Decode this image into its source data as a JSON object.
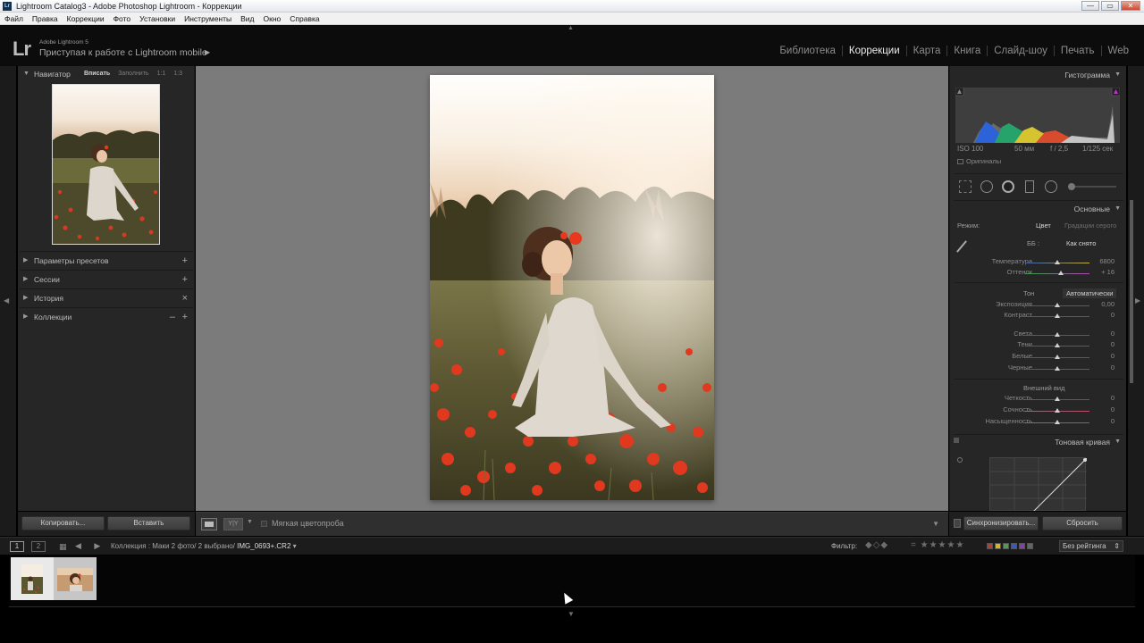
{
  "window": {
    "title": "Lightroom Catalog3 - Adobe Photoshop Lightroom - Коррекции",
    "app_icon": "Lr",
    "minimize": "—",
    "maximize": "▭",
    "close": "✕"
  },
  "menu": [
    "Файл",
    "Правка",
    "Коррекции",
    "Фото",
    "Установки",
    "Инструменты",
    "Вид",
    "Окно",
    "Справка"
  ],
  "identity": {
    "logo": "Lr",
    "version": "Adobe Lightroom 5",
    "mobile": "Приступая к работе с Lightroom mobile"
  },
  "modules": [
    {
      "label": "Библиотека",
      "active": false
    },
    {
      "label": "Коррекции",
      "active": true
    },
    {
      "label": "Карта",
      "active": false
    },
    {
      "label": "Книга",
      "active": false
    },
    {
      "label": "Слайд-шоу",
      "active": false
    },
    {
      "label": "Печать",
      "active": false
    },
    {
      "label": "Web",
      "active": false
    }
  ],
  "left_panel": {
    "navigator": {
      "title": "Навигатор",
      "opt_fit": "Вписать",
      "opt_fill": "Заполнить",
      "opt_1_1": "1:1",
      "opt_1_3": "1:3"
    },
    "presets": {
      "label": "Параметры пресетов",
      "action": "+"
    },
    "sessions": {
      "label": "Сессии",
      "action": "+"
    },
    "history": {
      "label": "История",
      "action": "×"
    },
    "collections": {
      "label": "Коллекции",
      "action_minus": "–",
      "action_plus": "+"
    },
    "copy_button": "Копировать...",
    "paste_button": "Вставить"
  },
  "right_panel": {
    "histogram": {
      "title": "Гистограмма",
      "iso": "ISO 100",
      "focal": "50 мм",
      "aperture": "f / 2,5",
      "shutter": "1/125 сек",
      "originals": "Оригиналы"
    },
    "basic": {
      "title": "Основные",
      "mode_label": "Режим:",
      "mode_color": "Цвет",
      "mode_gray": "Градации серого",
      "wb_label": "ББ :",
      "wb_value": "Как снято",
      "temp": {
        "label": "Температура",
        "value": "6800",
        "pos": 0.5
      },
      "tint": {
        "label": "Оттенок",
        "value": "+ 16",
        "pos": 0.55
      },
      "tone_label": "Тон",
      "auto": "Автоматически",
      "exposure": {
        "label": "Экспозиция",
        "value": "0,00",
        "pos": 0.5
      },
      "contrast": {
        "label": "Контраст",
        "value": "0",
        "pos": 0.5
      },
      "highlights": {
        "label": "Света",
        "value": "0",
        "pos": 0.5
      },
      "shadows": {
        "label": "Тени",
        "value": "0",
        "pos": 0.5
      },
      "whites": {
        "label": "Белые",
        "value": "0",
        "pos": 0.5
      },
      "blacks": {
        "label": "Черные",
        "value": "0",
        "pos": 0.5
      },
      "presence_label": "Внешний вид",
      "clarity": {
        "label": "Четкость",
        "value": "0",
        "pos": 0.5
      },
      "vibrance": {
        "label": "Сочность",
        "value": "0",
        "pos": 0.5
      },
      "saturation": {
        "label": "Насыщенность",
        "value": "0",
        "pos": 0.5
      }
    },
    "tone_curve": {
      "title": "Тоновая кривая"
    },
    "sync_button": "Синхронизировать...",
    "reset_button": "Сбросить"
  },
  "toolbar": {
    "soft_proof": "Мягкая цветопроба",
    "yy": "Y|Y",
    "menu_arrow": "▼"
  },
  "filmbar": {
    "mon1": "1",
    "mon2": "2",
    "arrows": "◀ ▶",
    "crumb_prefix": "Коллекция : Маки  2 фото/  2 выбрано/",
    "crumb_file": "IMG_0693+.CR2",
    "filter_label": "Фильтр:",
    "flags": "◆◇◆",
    "stars": "= ★★★★★",
    "rating_value": "Без рейтинга"
  },
  "colors": {
    "label_red": "#b83a3a",
    "label_yellow": "#c8b53a",
    "label_green": "#4aa04a",
    "label_blue": "#3a5ab8",
    "label_purple": "#8a3ab8",
    "label_none": "#666666"
  }
}
